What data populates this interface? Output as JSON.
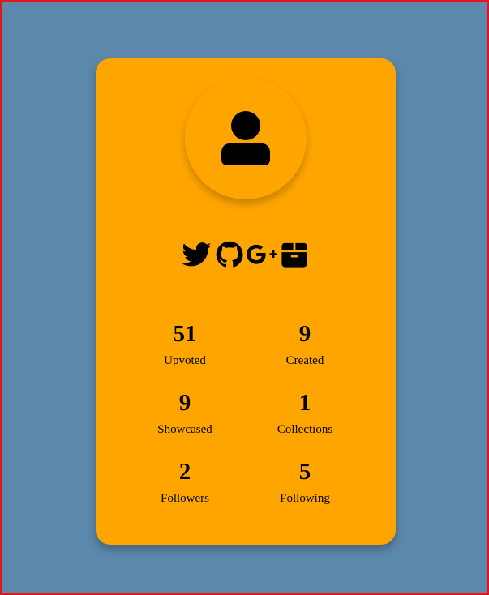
{
  "profile": {
    "avatar_icon": "user-icon",
    "social_icons": [
      "twitter-icon",
      "github-icon",
      "google-plus-icon",
      "box-icon"
    ],
    "stats": [
      {
        "value": "51",
        "label": "Upvoted"
      },
      {
        "value": "9",
        "label": "Created"
      },
      {
        "value": "9",
        "label": "Showcased"
      },
      {
        "value": "1",
        "label": "Collections"
      },
      {
        "value": "2",
        "label": "Followers"
      },
      {
        "value": "5",
        "label": "Following"
      }
    ]
  },
  "colors": {
    "background": "#5c88ab",
    "card": "#ffa500",
    "border": "#e8141b"
  }
}
